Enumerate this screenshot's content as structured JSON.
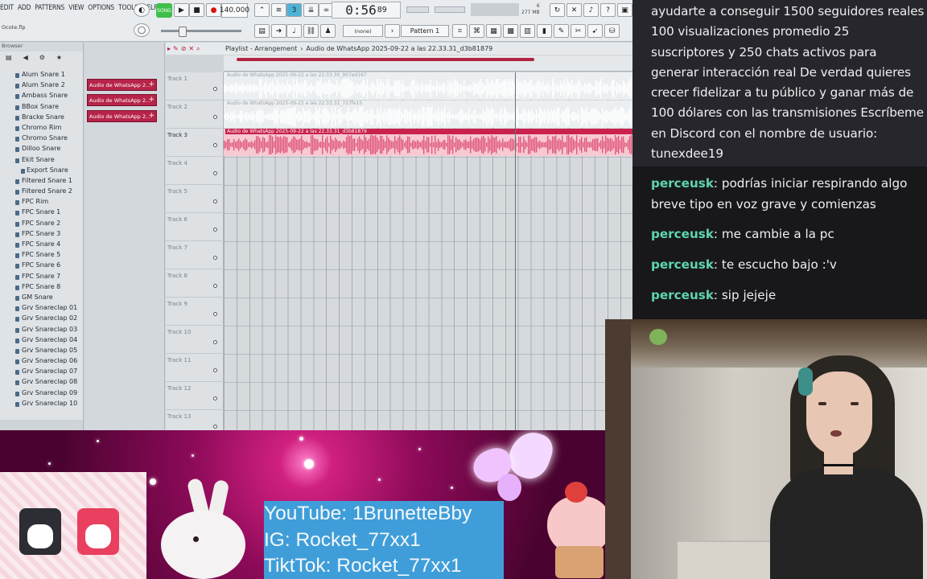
{
  "fl": {
    "menu": [
      "EDIT",
      "ADD",
      "PATTERNS",
      "VIEW",
      "OPTIONS",
      "TOOLS",
      "HELP"
    ],
    "project_name": "Ocote.flp",
    "song_label": "SONG",
    "bpm": "140.000",
    "time_main": "0:56",
    "time_frac": "89",
    "time_unit": "M:S:CS",
    "memory": "277 MB",
    "cpu": "6",
    "none_label": "(none)",
    "pattern_label": "Pattern 1",
    "browser_title": "Browser",
    "browser_items": [
      {
        "label": "Alum Snare 1",
        "sub": false
      },
      {
        "label": "Alum Snare 2",
        "sub": false
      },
      {
        "label": "Ambass Snare",
        "sub": false
      },
      {
        "label": "BBox Snare",
        "sub": false
      },
      {
        "label": "Bracke Snare",
        "sub": false
      },
      {
        "label": "Chromo Rim",
        "sub": false
      },
      {
        "label": "Chromo Snare",
        "sub": false
      },
      {
        "label": "Dilloo Snare",
        "sub": false
      },
      {
        "label": "Ekit Snare",
        "sub": false
      },
      {
        "label": "Export Snare",
        "sub": true
      },
      {
        "label": "Filtered Snare 1",
        "sub": false
      },
      {
        "label": "Filtered Snare 2",
        "sub": false
      },
      {
        "label": "FPC Rim",
        "sub": false
      },
      {
        "label": "FPC Snare 1",
        "sub": false
      },
      {
        "label": "FPC Snare 2",
        "sub": false
      },
      {
        "label": "FPC Snare 3",
        "sub": false
      },
      {
        "label": "FPC Snare 4",
        "sub": false
      },
      {
        "label": "FPC Snare 5",
        "sub": false
      },
      {
        "label": "FPC Snare 6",
        "sub": false
      },
      {
        "label": "FPC Snare 7",
        "sub": false
      },
      {
        "label": "FPC Snare 8",
        "sub": false
      },
      {
        "label": "GM Snare",
        "sub": false
      },
      {
        "label": "Grv Snareclap 01",
        "sub": false
      },
      {
        "label": "Grv Snareclap 02",
        "sub": false
      },
      {
        "label": "Grv Snareclap 03",
        "sub": false
      },
      {
        "label": "Grv Snareclap 04",
        "sub": false
      },
      {
        "label": "Grv Snareclap 05",
        "sub": false
      },
      {
        "label": "Grv Snareclap 06",
        "sub": false
      },
      {
        "label": "Grv Snareclap 07",
        "sub": false
      },
      {
        "label": "Grv Snareclap 08",
        "sub": false
      },
      {
        "label": "Grv Snareclap 09",
        "sub": false
      },
      {
        "label": "Grv Snareclap 10",
        "sub": false
      }
    ],
    "picker_clips": [
      "Audio de WhatsApp 2...",
      "Audio de WhatsApp 2...",
      "Audio de WhatsApp 2..."
    ],
    "playlist_title": "Playlist - Arrangement",
    "playlist_clip_title": "Audio de WhatsApp 2025-09-22 a las 22.33.31_d3b81879",
    "tracks": [
      "Track 1",
      "Track 2",
      "Track 3",
      "Track 4",
      "Track 5",
      "Track 6",
      "Track 7",
      "Track 8",
      "Track 9",
      "Track 10",
      "Track 11",
      "Track 12",
      "Track 13"
    ],
    "clips": [
      {
        "label": "Audio de WhatsApp 2025-09-22 a las 22.33.30_907ed167",
        "state": "faded"
      },
      {
        "label": "Audio de WhatsApp 2025-09-22 a las 22.33.31_727fe15",
        "state": "faded"
      },
      {
        "label": "Audio de WhatsApp 2025-09-22 a las 22.33.31_d3b81879",
        "state": "active"
      }
    ],
    "colors": {
      "accent": "#c9224d",
      "song_green": "#3fbf4c"
    }
  },
  "chat": {
    "top_lines": [
      "ayudarte a conseguir 1500 seguidores reales",
      "100 visualizaciones promedio 25",
      "suscriptores y 250 chats activos para",
      "generar interacción real De verdad quieres",
      "crecer fidelizar a tu público y ganar más de",
      "100 dólares con las transmisiones Escríbeme",
      "en Discord con el nombre de usuario:",
      "tunexdee19"
    ],
    "messages": [
      {
        "user": "perceusk",
        "text": ": podrías iniciar respirando algo breve tipo en voz grave y comienzas"
      },
      {
        "user": "perceusk",
        "text": ": me cambie a la pc"
      },
      {
        "user": "perceusk",
        "text": ": te escucho bajo :'v"
      },
      {
        "user": "perceusk",
        "text": ": sip jejeje"
      }
    ],
    "colors": {
      "username": "#5fd4b0",
      "text": "#efeff1"
    }
  },
  "banner": {
    "youtube": "YouTube: 1BrunetteBby",
    "instagram": "IG: Rocket_77xx1",
    "tiktok": "TiktTok: Rocket_77xx1"
  }
}
